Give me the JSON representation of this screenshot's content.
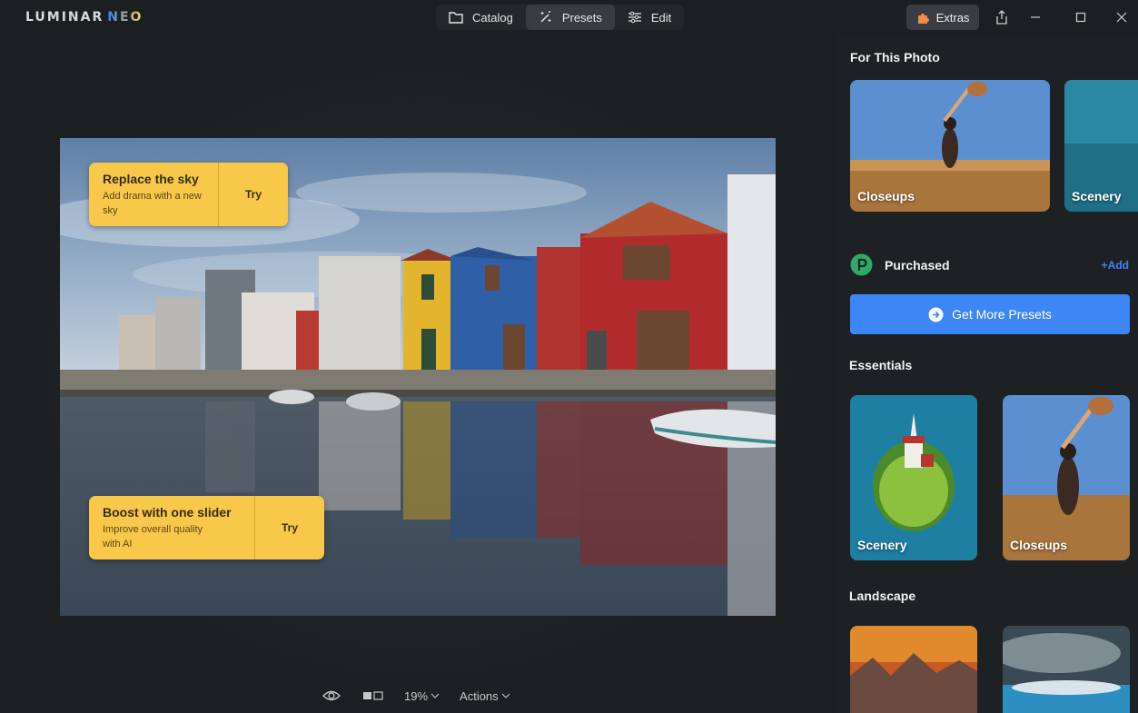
{
  "app": {
    "logo_main": "LUMINAR",
    "logo_sub": "NEO"
  },
  "modes": [
    {
      "label": "Catalog",
      "icon": "folder-icon",
      "active": false
    },
    {
      "label": "Presets",
      "icon": "magic-wand-icon",
      "active": true
    },
    {
      "label": "Edit",
      "icon": "sliders-icon",
      "active": false
    }
  ],
  "extras": {
    "label": "Extras",
    "icon": "puzzle-icon"
  },
  "tips": [
    {
      "title": "Replace the sky",
      "desc": "Add drama with a new sky",
      "action": "Try"
    },
    {
      "title": "Boost with one slider",
      "desc": "Improve overall quality with AI",
      "action": "Try"
    }
  ],
  "bottom": {
    "zoom": "19%",
    "actions": "Actions"
  },
  "panel": {
    "for_this_photo": {
      "title": "For This Photo",
      "cards": [
        "Closeups",
        "Scenery"
      ]
    },
    "purchased": {
      "title": "Purchased",
      "add": "+Add"
    },
    "get_more": "Get More Presets",
    "essentials": {
      "title": "Essentials",
      "cards": [
        "Scenery",
        "Closeups"
      ]
    },
    "landscape": {
      "title": "Landscape"
    }
  },
  "colors": {
    "accent": "#3d86f5",
    "tip": "#f7c84a",
    "purchased_icon": "#2fa86a"
  }
}
